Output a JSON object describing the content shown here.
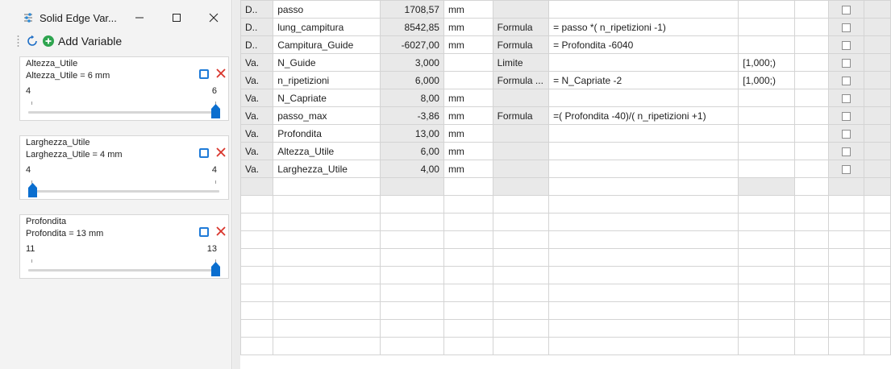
{
  "window": {
    "title": "Solid Edge Var...",
    "add_variable_label": "Add Variable"
  },
  "cards": [
    {
      "name": "Altezza_Utile",
      "value_text": "Altezza_Utile = 6 mm",
      "min_label": "4",
      "max_label": "6",
      "slider_fraction": 1.0
    },
    {
      "name": "Larghezza_Utile",
      "value_text": "Larghezza_Utile = 4 mm",
      "min_label": "4",
      "max_label": "4",
      "slider_fraction": 0.0
    },
    {
      "name": "Profondita",
      "value_text": "Profondita = 13 mm",
      "min_label": "11",
      "max_label": "13",
      "slider_fraction": 1.0
    }
  ],
  "table": {
    "rows": [
      {
        "type": "D..",
        "name": "passo",
        "value": "1708,57",
        "unit": "mm",
        "rule": "",
        "formula": "",
        "range": ""
      },
      {
        "type": "D..",
        "name": "lung_campitura",
        "value": "8542,85",
        "unit": "mm",
        "rule": "Formula",
        "formula": "= passo *( n_ripetizioni -1)",
        "range": ""
      },
      {
        "type": "D..",
        "name": "Campitura_Guide",
        "value": "-6027,00",
        "unit": "mm",
        "rule": "Formula",
        "formula": "= Profondita -6040",
        "range": ""
      },
      {
        "type": "Va.",
        "name": "N_Guide",
        "value": "3,000",
        "unit": "",
        "rule": "Limite",
        "formula": "",
        "range": "[1,000;)"
      },
      {
        "type": "Va.",
        "name": "n_ripetizioni",
        "value": "6,000",
        "unit": "",
        "rule": "Formula ...",
        "formula": "= N_Capriate -2",
        "range": "[1,000;)"
      },
      {
        "type": "Va.",
        "name": "N_Capriate",
        "value": "8,00",
        "unit": "mm",
        "rule": "",
        "formula": "",
        "range": ""
      },
      {
        "type": "Va.",
        "name": "passo_max",
        "value": "-3,86",
        "unit": "mm",
        "rule": "Formula",
        "formula": "=( Profondita -40)/( n_ripetizioni +1)",
        "range": ""
      },
      {
        "type": "Va.",
        "name": "Profondita",
        "value": "13,00",
        "unit": "mm",
        "rule": "",
        "formula": "",
        "range": ""
      },
      {
        "type": "Va.",
        "name": "Altezza_Utile",
        "value": "6,00",
        "unit": "mm",
        "rule": "",
        "formula": "",
        "range": ""
      },
      {
        "type": "Va.",
        "name": "Larghezza_Utile",
        "value": "4,00",
        "unit": "mm",
        "rule": "",
        "formula": "",
        "range": ""
      }
    ]
  },
  "colors": {
    "accent": "#1f7bd8",
    "delete": "#d9342b",
    "add_green": "#2ea44f",
    "grid_gray": "#e9e9e9"
  },
  "icons": {
    "app": "sliders-icon",
    "refresh": "refresh-icon",
    "add": "plus-circle-icon",
    "minimize": "minimize-icon",
    "maximize": "maximize-icon",
    "close": "close-icon",
    "delete": "delete-x-icon"
  }
}
